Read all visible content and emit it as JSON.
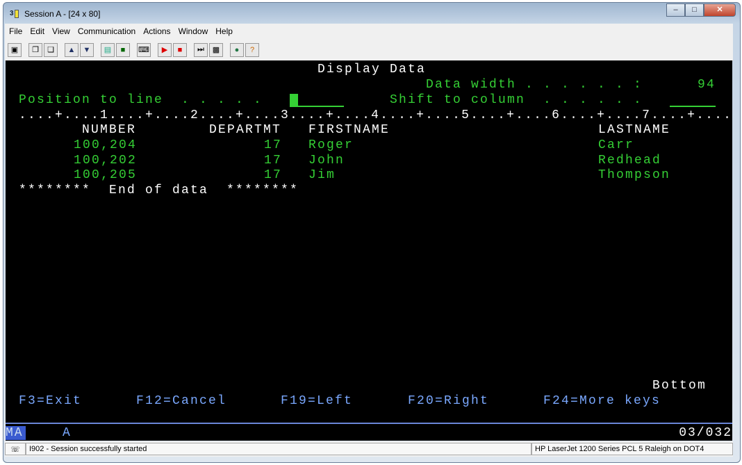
{
  "window": {
    "title": "Session A - [24 x 80]",
    "controls": [
      "minimize",
      "maximize",
      "close"
    ]
  },
  "menu": [
    "File",
    "Edit",
    "View",
    "Communication",
    "Actions",
    "Window",
    "Help"
  ],
  "toolbar": [
    "screen-icon",
    "copy-icon",
    "paste-icon",
    "send-file-icon",
    "receive-file-icon",
    "display-icon",
    "color-icon",
    "keyboard-icon",
    "record-macro-icon",
    "stop-macro-icon",
    "play-macro-icon",
    "macro-icon",
    "web-icon",
    "help-icon"
  ],
  "screen": {
    "title": "Display Data",
    "data_width_label": "Data width . . . . . . :",
    "data_width_value": "94",
    "position_label": "Position to line  . . . . .",
    "shift_label": "Shift to column  . . . . . .",
    "ruler": "....+....1....+....2....+....3....+....4....+....5....+....6....+....7....+....",
    "headers": {
      "number": "NUMBER",
      "department": "DEPARTMT",
      "firstname": "FIRSTNAME",
      "lastname": "LASTNAME"
    },
    "rows": [
      {
        "number": "100,204",
        "department": "17",
        "firstname": "Roger",
        "lastname": "Carr"
      },
      {
        "number": "100,202",
        "department": "17",
        "firstname": "John",
        "lastname": "Redhead"
      },
      {
        "number": "100,205",
        "department": "17",
        "firstname": "Jim",
        "lastname": "Thompson"
      }
    ],
    "end": "********  End of data  ********",
    "bottom": "Bottom",
    "fkeys": [
      "F3=Exit",
      "F12=Cancel",
      "F19=Left",
      "F20=Right",
      "F24=More keys"
    ]
  },
  "oia": {
    "ma": "MA",
    "indicator": "A",
    "cursor_pos": "03/032"
  },
  "statusbar": {
    "message": "I902 - Session successfully started",
    "printer": "HP LaserJet 1200 Series PCL 5 Raleigh on DOT4"
  }
}
